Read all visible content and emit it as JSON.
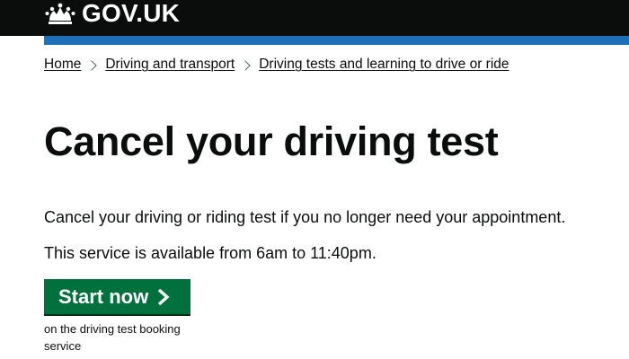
{
  "header": {
    "logo_text": "GOV.UK",
    "logo_icon": "crown-icon",
    "background_color": "#0b0c0c",
    "accent_bar_color": "#1d70b8"
  },
  "breadcrumb": {
    "items": [
      {
        "label": "Home"
      },
      {
        "label": "Driving and transport"
      },
      {
        "label": "Driving tests and learning to drive or ride"
      }
    ],
    "separator_icon": "chevron-right-icon"
  },
  "main": {
    "title": "Cancel your driving test",
    "paragraphs": [
      "Cancel your driving or riding test if you no longer need your appointment.",
      "This service is available from 6am to 11:40pm."
    ],
    "start_button": {
      "label": "Start now",
      "icon": "chevron-right-icon",
      "color": "#00703c"
    },
    "start_caption": "on the driving test booking service"
  }
}
